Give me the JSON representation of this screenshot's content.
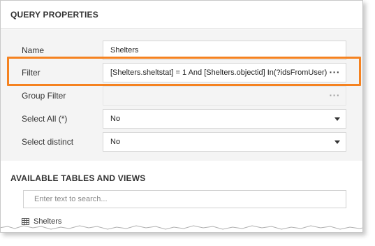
{
  "query_properties": {
    "title": "QUERY PROPERTIES",
    "name": {
      "label": "Name",
      "value": "Shelters"
    },
    "filter": {
      "label": "Filter",
      "value": "[Shelters.sheltstat] = 1 And [Shelters.objectid] In(?idsFromUser)",
      "button": "···"
    },
    "group_filter": {
      "label": "Group Filter",
      "value": "",
      "button": "···"
    },
    "select_all": {
      "label": "Select All (*)",
      "value": "No"
    },
    "select_distinct": {
      "label": "Select distinct",
      "value": "No"
    }
  },
  "available_tables": {
    "title": "AVAILABLE TABLES AND VIEWS",
    "search_placeholder": "Enter text to search...",
    "items": [
      {
        "label": "Shelters",
        "icon": "table-icon"
      }
    ]
  },
  "colors": {
    "highlight": "#f58220",
    "panel_background": "#f4f4f4"
  }
}
